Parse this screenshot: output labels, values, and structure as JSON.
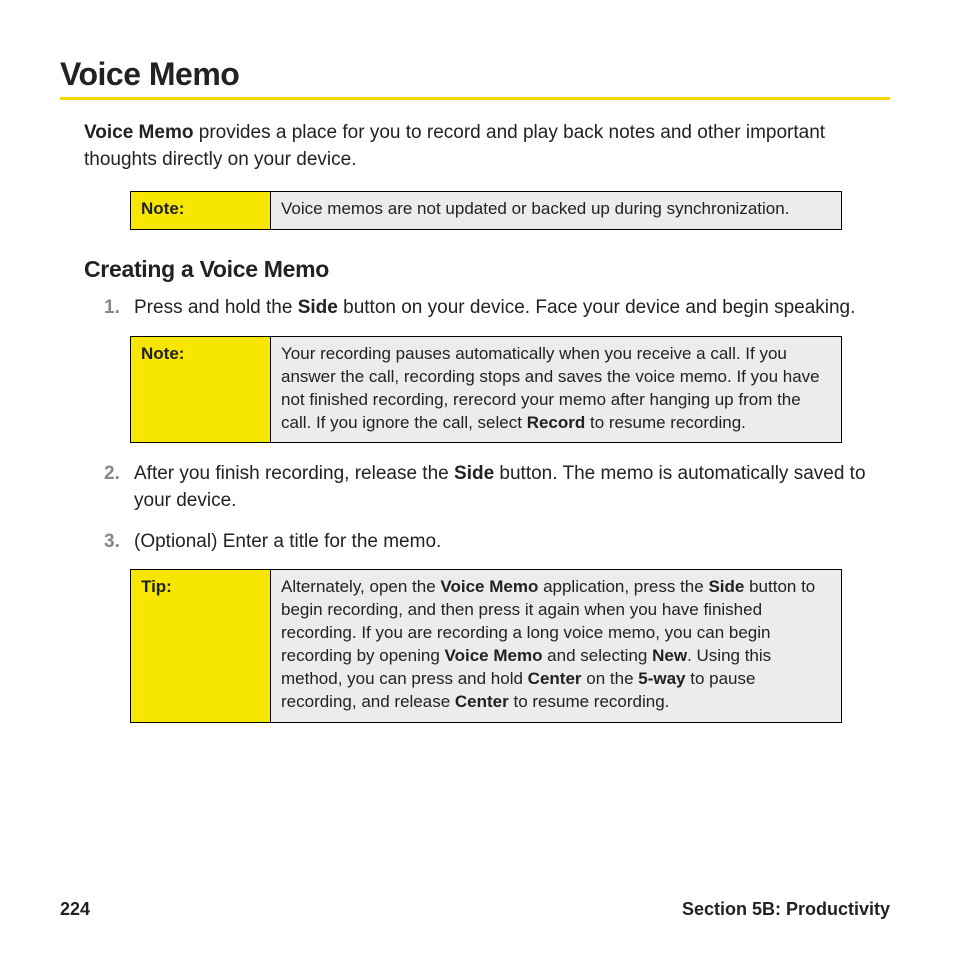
{
  "title": "Voice Memo",
  "intro": {
    "bold": "Voice Memo",
    "rest": " provides a place for you to record and play back notes and other important thoughts directly on your device."
  },
  "note1": {
    "label": "Note:",
    "body": "Voice memos are not updated or backed up during synchronization."
  },
  "subhead": "Creating a Voice Memo",
  "step1": {
    "num": "1.",
    "pre": "Press and hold the ",
    "b1": "Side",
    "post": " button on your device. Face your device and begin speaking."
  },
  "note2": {
    "label": "Note:",
    "p1": "Your recording pauses automatically when you receive a call. If you answer the call, recording stops and saves the voice memo. If you have not finished recording, rerecord your memo after hanging up from the call. If you ignore the call, select ",
    "b1": "Record",
    "p2": " to resume recording."
  },
  "step2": {
    "num": "2.",
    "pre": "After you finish recording, release the ",
    "b1": "Side",
    "post": " button. The memo is automatically saved to your device."
  },
  "step3": {
    "num": "3.",
    "text": "(Optional) Enter a title for the memo."
  },
  "tip": {
    "label": "Tip:",
    "p1": "Alternately, open the ",
    "b1": "Voice Memo",
    "p2": " application, press the ",
    "b2": "Side",
    "p3": " button to begin recording, and then press it again when you have finished recording. If you are recording a long voice memo, you can begin recording by opening ",
    "b3": "Voice Memo",
    "p4": " and selecting ",
    "b4": "New",
    "p5": ". Using this method, you can press and hold ",
    "b5": "Center",
    "p6": " on the ",
    "b6": "5-way",
    "p7": " to pause recording, and release ",
    "b7": "Center",
    "p8": " to resume recording."
  },
  "footer": {
    "page": "224",
    "section": "Section 5B: Productivity"
  }
}
